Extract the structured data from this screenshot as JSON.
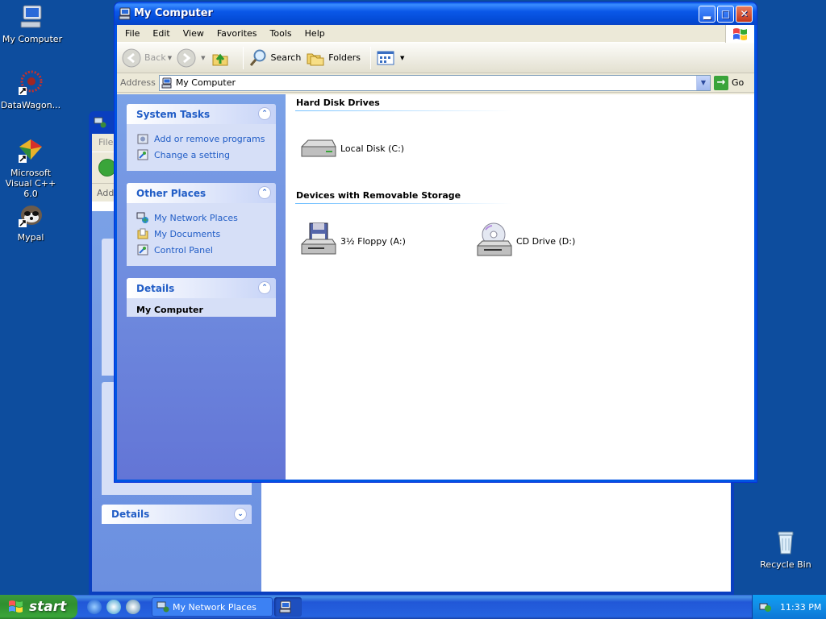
{
  "desktop": {
    "icons": [
      {
        "label": "My Computer"
      },
      {
        "label": "DataWagon..."
      },
      {
        "label": "Microsoft Visual C++ 6.0"
      },
      {
        "label": "Mypal"
      },
      {
        "label": "Recycle Bin"
      }
    ]
  },
  "background_window": {
    "menu_fragment": "File",
    "address_fragment": "Add",
    "details_label": "Details"
  },
  "window": {
    "title": "My Computer",
    "menu": [
      "File",
      "Edit",
      "View",
      "Favorites",
      "Tools",
      "Help"
    ],
    "toolbar": {
      "back": "Back",
      "search": "Search",
      "folders": "Folders"
    },
    "address": {
      "label": "Address",
      "value": "My Computer",
      "go": "Go"
    },
    "taskpane": {
      "system_tasks": {
        "title": "System Tasks",
        "links": [
          "Add or remove programs",
          "Change a setting"
        ]
      },
      "other_places": {
        "title": "Other Places",
        "links": [
          "My Network Places",
          "My Documents",
          "Control Panel"
        ]
      },
      "details": {
        "title": "Details",
        "value": "My Computer"
      }
    },
    "groups": [
      {
        "title": "Hard Disk Drives",
        "items": [
          "Local Disk (C:)"
        ]
      },
      {
        "title": "Devices with Removable Storage",
        "items": [
          "3½ Floppy (A:)",
          "CD Drive (D:)"
        ]
      }
    ]
  },
  "taskbar": {
    "start": "start",
    "tasks": [
      "My Network Places"
    ],
    "clock": "11:33 PM"
  },
  "colors": {
    "desktop": "#0d4d9e",
    "title_blue": "#0054e3",
    "taskpane_link": "#215dc6",
    "start_green": "#3c9a3c"
  }
}
